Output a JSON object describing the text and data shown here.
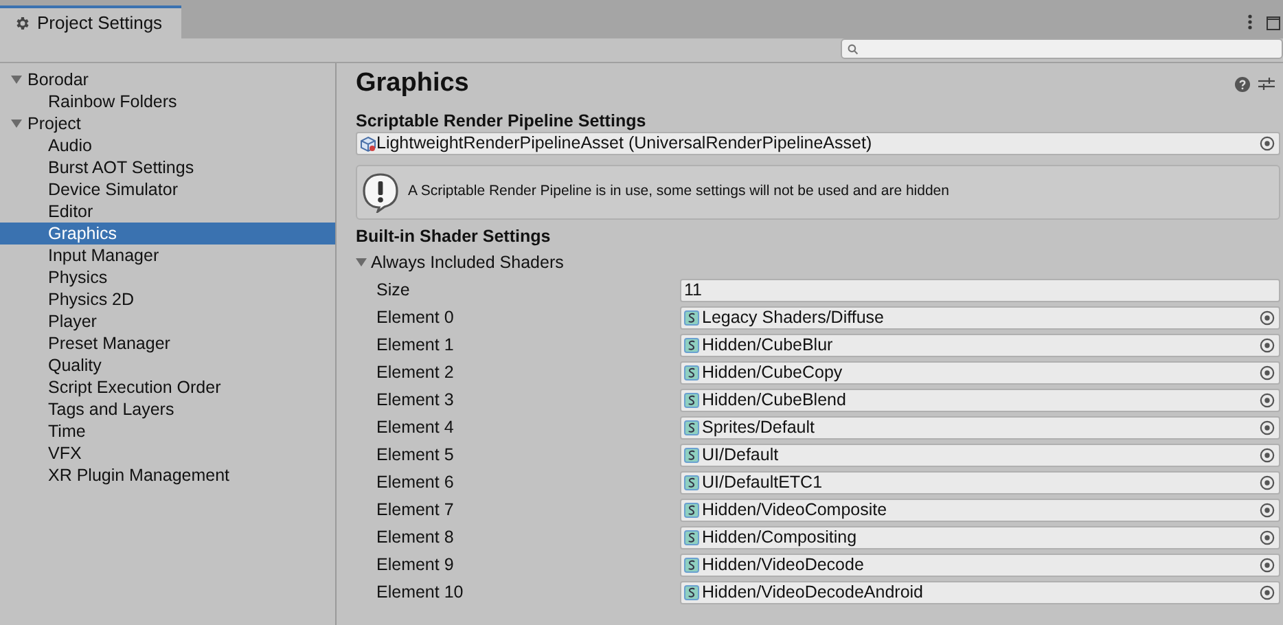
{
  "window": {
    "title": "Project Settings"
  },
  "sidebar": {
    "groups": [
      {
        "label": "Borodar",
        "expanded": true,
        "children": [
          {
            "label": "Rainbow Folders",
            "selected": false
          }
        ]
      },
      {
        "label": "Project",
        "expanded": true,
        "children": [
          {
            "label": "Audio",
            "selected": false
          },
          {
            "label": "Burst AOT Settings",
            "selected": false
          },
          {
            "label": "Device Simulator",
            "selected": false
          },
          {
            "label": "Editor",
            "selected": false
          },
          {
            "label": "Graphics",
            "selected": true
          },
          {
            "label": "Input Manager",
            "selected": false
          },
          {
            "label": "Physics",
            "selected": false
          },
          {
            "label": "Physics 2D",
            "selected": false
          },
          {
            "label": "Player",
            "selected": false
          },
          {
            "label": "Preset Manager",
            "selected": false
          },
          {
            "label": "Quality",
            "selected": false
          },
          {
            "label": "Script Execution Order",
            "selected": false
          },
          {
            "label": "Tags and Layers",
            "selected": false
          },
          {
            "label": "Time",
            "selected": false
          },
          {
            "label": "VFX",
            "selected": false
          },
          {
            "label": "XR Plugin Management",
            "selected": false
          }
        ]
      }
    ]
  },
  "content": {
    "title": "Graphics",
    "srp": {
      "heading": "Scriptable Render Pipeline Settings",
      "value": "LightweightRenderPipelineAsset (UniversalRenderPipelineAsset)",
      "help": "A Scriptable Render Pipeline is in use, some settings will not be used and are hidden"
    },
    "builtin": {
      "heading": "Built-in Shader Settings",
      "foldout": {
        "label": "Always Included Shaders",
        "expanded": true
      },
      "size": {
        "label": "Size",
        "value": "11"
      },
      "elements": [
        {
          "label": "Element 0",
          "value": "Legacy Shaders/Diffuse"
        },
        {
          "label": "Element 1",
          "value": "Hidden/CubeBlur"
        },
        {
          "label": "Element 2",
          "value": "Hidden/CubeCopy"
        },
        {
          "label": "Element 3",
          "value": "Hidden/CubeBlend"
        },
        {
          "label": "Element 4",
          "value": "Sprites/Default"
        },
        {
          "label": "Element 5",
          "value": "UI/Default"
        },
        {
          "label": "Element 6",
          "value": "UI/DefaultETC1"
        },
        {
          "label": "Element 7",
          "value": "Hidden/VideoComposite"
        },
        {
          "label": "Element 8",
          "value": "Hidden/Compositing"
        },
        {
          "label": "Element 9",
          "value": "Hidden/VideoDecode"
        },
        {
          "label": "Element 10",
          "value": "Hidden/VideoDecodeAndroid"
        }
      ]
    }
  }
}
